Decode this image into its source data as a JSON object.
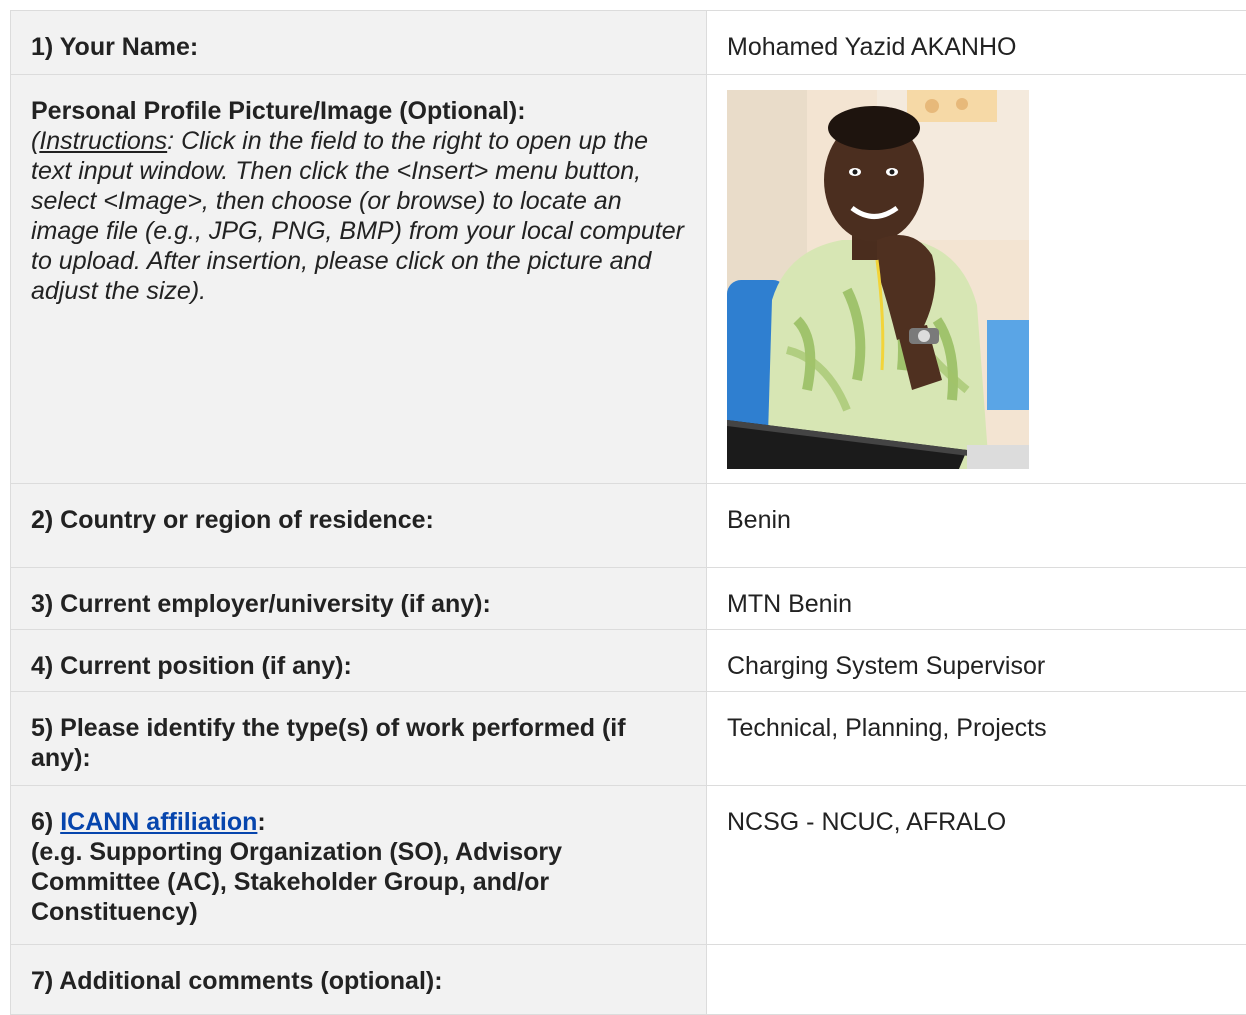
{
  "rows": {
    "name": {
      "label": "1) Your Name:",
      "value": "Mohamed Yazid AKANHO"
    },
    "picture": {
      "label": "Personal Profile Picture/Image (Optional):",
      "instructions_open": "(",
      "instructions_word": "Instructions",
      "instructions_text": ": Click in the field to the right to open up the text input window. Then click the <Insert> menu button, select <Image>, then choose (or browse) to locate an image file (e.g., JPG, PNG, BMP) from your local computer to upload. After insertion, please click on the picture and adjust the size)."
    },
    "country": {
      "label": "2) Country or region of residence:",
      "value": "Benin"
    },
    "employer": {
      "label": "3) Current employer/university (if any):",
      "value": "MTN Benin"
    },
    "position": {
      "label": "4) Current position (if any):",
      "value": "Charging System Supervisor"
    },
    "work_type": {
      "label": "5) Please identify the type(s) of work performed (if any):",
      "value": "Technical, Planning, Projects"
    },
    "affiliation": {
      "label_prefix": "6) ",
      "link_text": "ICANN affiliation",
      "label_suffix": ":",
      "label_detail": "(e.g. Supporting Organization (SO), Advisory Committee (AC), Stakeholder Group, and/or Constituency)",
      "value": "NCSG - NCUC, AFRALO"
    },
    "comments": {
      "label": "7) Additional comments (optional):",
      "value": ""
    }
  },
  "colors": {
    "label_bg": "#f2f2f2",
    "border": "#dcdcdc",
    "link": "#0645ad"
  }
}
